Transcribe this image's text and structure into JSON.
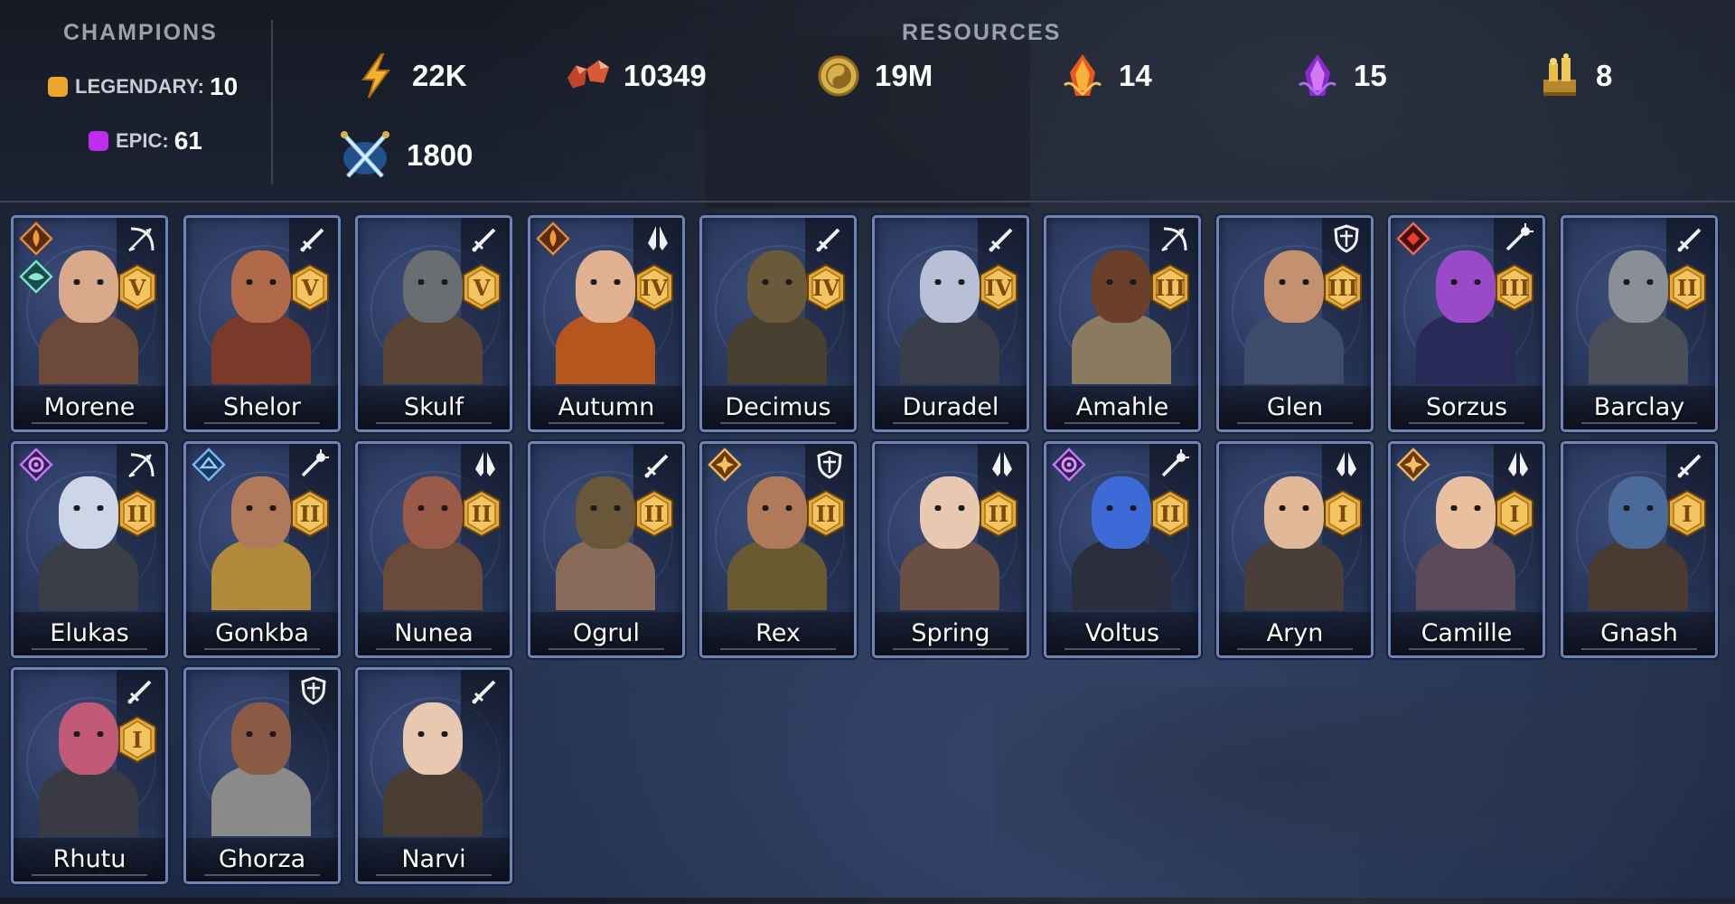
{
  "champions_header": {
    "title": "CHAMPIONS",
    "legendary_label": "LEGENDARY:",
    "legendary_count": "10",
    "legendary_color": "#f0a52a",
    "epic_label": "EPIC:",
    "epic_count": "61",
    "epic_color": "#c02cf0"
  },
  "resources": {
    "title": "RESOURCES",
    "energy": "22K",
    "rubies": "10349",
    "silver": "19M",
    "fire_shards": "14",
    "void_shards": "15",
    "trophies": "8",
    "arena_tokens": "1800"
  },
  "champions": [
    {
      "name": "Morene",
      "rank": "V",
      "class": "bow",
      "affinities": [
        "fire",
        "nature"
      ],
      "palette": [
        "#d9a98c",
        "#6b4a3a"
      ]
    },
    {
      "name": "Shelor",
      "rank": "V",
      "class": "sword",
      "affinities": [],
      "palette": [
        "#b06a4a",
        "#7a3a2a"
      ]
    },
    {
      "name": "Skulf",
      "rank": "V",
      "class": "sword",
      "affinities": [],
      "palette": [
        "#6b6e70",
        "#5a4436"
      ]
    },
    {
      "name": "Autumn",
      "rank": "IV",
      "class": "prayer",
      "affinities": [
        "fire"
      ],
      "palette": [
        "#e0b090",
        "#b5561e"
      ]
    },
    {
      "name": "Decimus",
      "rank": "IV",
      "class": "sword",
      "affinities": [],
      "palette": [
        "#6a5a3a",
        "#4a4032"
      ]
    },
    {
      "name": "Duradel",
      "rank": "IV",
      "class": "sword",
      "affinities": [],
      "palette": [
        "#b8c0d8",
        "#3a3e4a"
      ]
    },
    {
      "name": "Amahle",
      "rank": "III",
      "class": "bow",
      "affinities": [],
      "palette": [
        "#6a4028",
        "#8a7a60"
      ]
    },
    {
      "name": "Glen",
      "rank": "III",
      "class": "shield",
      "affinities": [],
      "palette": [
        "#c49070",
        "#3e4c6c"
      ]
    },
    {
      "name": "Sorzus",
      "rank": "III",
      "class": "staff",
      "affinities": [
        "void-red"
      ],
      "palette": [
        "#9a4ac8",
        "#2a2a58"
      ]
    },
    {
      "name": "Barclay",
      "rank": "II",
      "class": "sword",
      "affinities": [],
      "palette": [
        "#8a8e96",
        "#4a4e58"
      ]
    },
    {
      "name": "Elukas",
      "rank": "II",
      "class": "bow",
      "affinities": [
        "void"
      ],
      "palette": [
        "#cdd6e6",
        "#3a3e46"
      ]
    },
    {
      "name": "Gonkba",
      "rank": "II",
      "class": "staff",
      "affinities": [
        "magic"
      ],
      "palette": [
        "#b07a5a",
        "#b08a3a"
      ]
    },
    {
      "name": "Nunea",
      "rank": "II",
      "class": "prayer",
      "affinities": [],
      "palette": [
        "#9a5a48",
        "#6a4a3a"
      ]
    },
    {
      "name": "Ogrul",
      "rank": "II",
      "class": "sword",
      "affinities": [],
      "palette": [
        "#6a5638",
        "#8a6a58"
      ]
    },
    {
      "name": "Rex",
      "rank": "II",
      "class": "shield",
      "affinities": [
        "force"
      ],
      "palette": [
        "#b07a5a",
        "#6a5a32"
      ]
    },
    {
      "name": "Spring",
      "rank": "II",
      "class": "prayer",
      "affinities": [],
      "palette": [
        "#e8c8b0",
        "#6a5044"
      ]
    },
    {
      "name": "Voltus",
      "rank": "II",
      "class": "staff",
      "affinities": [
        "void"
      ],
      "palette": [
        "#3e6ad8",
        "#2a2e3e"
      ]
    },
    {
      "name": "Aryn",
      "rank": "I",
      "class": "prayer",
      "affinities": [],
      "palette": [
        "#e0b898",
        "#4a3e3a"
      ]
    },
    {
      "name": "Camille",
      "rank": "I",
      "class": "prayer",
      "affinities": [
        "force"
      ],
      "palette": [
        "#e8c0a0",
        "#5a4a5a"
      ]
    },
    {
      "name": "Gnash",
      "rank": "I",
      "class": "sword",
      "affinities": [],
      "palette": [
        "#4a6a9a",
        "#4a3a32"
      ]
    },
    {
      "name": "Rhutu",
      "rank": "I",
      "class": "sword",
      "affinities": [],
      "palette": [
        "#c05a78",
        "#3a3a44"
      ]
    },
    {
      "name": "Ghorza",
      "rank": "",
      "class": "shield",
      "affinities": [],
      "palette": [
        "#8a5a44",
        "#8a8a8a"
      ]
    },
    {
      "name": "Narvi",
      "rank": "",
      "class": "sword",
      "affinities": [],
      "palette": [
        "#e8c8b0",
        "#4a3e34"
      ]
    }
  ]
}
